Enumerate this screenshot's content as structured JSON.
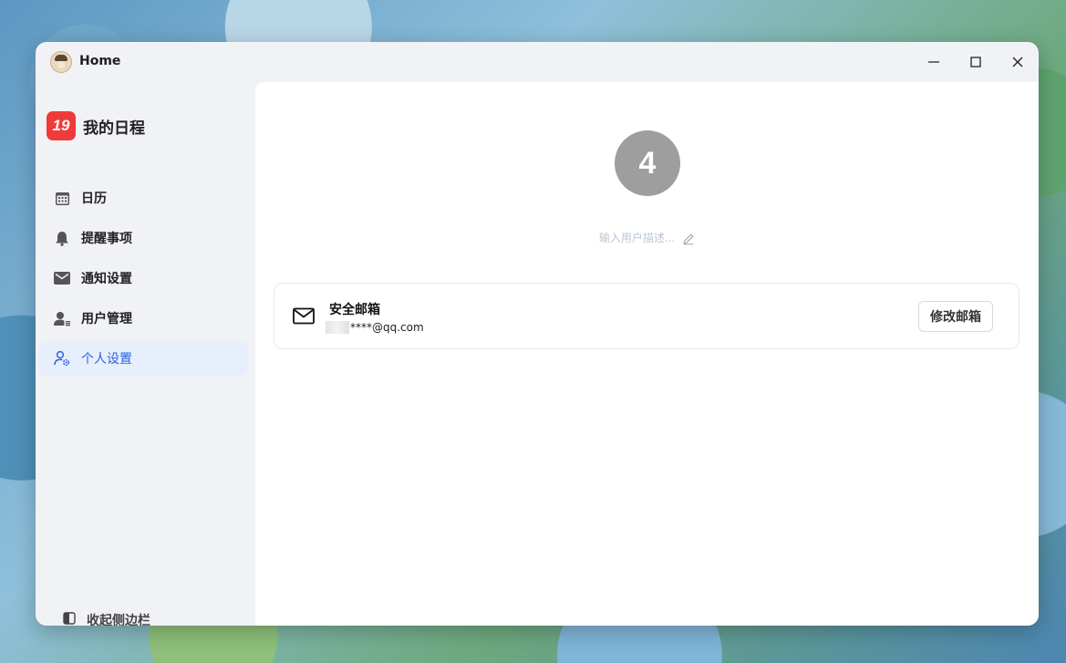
{
  "window": {
    "title": "Home"
  },
  "brand": {
    "logo_text": "19",
    "name": "我的日程",
    "logo_color": "#ef3a3a"
  },
  "sidebar": {
    "items": [
      {
        "label": "日历",
        "icon": "calendar-icon",
        "active": false
      },
      {
        "label": "提醒事项",
        "icon": "bell-icon",
        "active": false
      },
      {
        "label": "通知设置",
        "icon": "mail-icon",
        "active": false
      },
      {
        "label": "用户管理",
        "icon": "user-list-icon",
        "active": false
      },
      {
        "label": "个人设置",
        "icon": "user-gear-icon",
        "active": true
      }
    ],
    "collapse_label": "收起侧边栏"
  },
  "profile": {
    "avatar_text": "4",
    "description_placeholder": "输入用户描述..."
  },
  "security_email": {
    "title": "安全邮箱",
    "email": "****@qq.com",
    "edit_label": "修改邮箱"
  },
  "colors": {
    "accent": "#2b63d9",
    "active_bg": "#e7eefc"
  }
}
